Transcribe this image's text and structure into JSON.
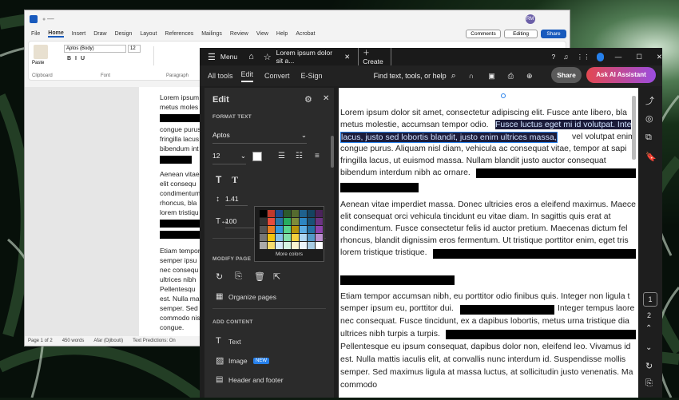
{
  "word": {
    "menu": [
      "File",
      "Home",
      "Insert",
      "Draw",
      "Design",
      "Layout",
      "References",
      "Mailings",
      "Review",
      "View",
      "Help",
      "Acrobat"
    ],
    "comments_label": "Comments",
    "editing_label": "Editing",
    "share_label": "Share",
    "font": "Aptos (Body)",
    "font_size": "12",
    "paste_label": "Paste",
    "ribbon_groups": [
      "Clipboard",
      "Font",
      "Paragraph"
    ],
    "lines": [
      "Lorem ipsum",
      "metus moles",
      "congue purus",
      "fringilla lacus",
      "bibendum int",
      "Aenean vitae",
      "elit consequ",
      "condimentum",
      "rhoncus, bla",
      "lorem tristiqu",
      "Etiam tempor",
      "semper ipsu",
      "nec consequ",
      "ultrices nibh",
      "Pellentesqu",
      "est. Nulla ma",
      "semper. Sed",
      "commodo nis",
      "congue."
    ],
    "status": [
      "Page 1 of 2",
      "450 words",
      "Afar (Djibouti)",
      "Text Predictions: On"
    ]
  },
  "acrobat": {
    "menu_label": "Menu",
    "tab_title": "Lorem ipsum dolor sit a...",
    "create_label": "Create",
    "nav": [
      "All tools",
      "Edit",
      "Convert",
      "E-Sign"
    ],
    "search_placeholder": "Find text, tools, or help",
    "share_label": "Share",
    "ai_label": "Ask AI Assistant",
    "panel": {
      "title": "Edit",
      "format_text": "FORMAT TEXT",
      "font": "Aptos",
      "size": "12",
      "line_spacing": "1.41",
      "scale": "100",
      "more_colors": "More colors",
      "modify_page": "MODIFY PAGE",
      "organize": "Organize pages",
      "add_content": "ADD CONTENT",
      "text": "Text",
      "image": "Image",
      "new_badge": "NEW",
      "header_footer": "Header and footer"
    },
    "doc_lines": [
      "Lorem ipsum dolor sit amet, consectetur adipiscing elit. Fusce ante libero, bla",
      "metus molestie, accumsan tempor odio.",
      "Fusce luctus eget mi id volutpat. Inte",
      "lacus, justo sed lobortis blandit, justo enim ultrices massa,",
      "vel volutpat enim",
      "congue purus. Aliquam nisl diam, vehicula ac consequat vitae, tempor at sapi",
      "fringilla lacus, ut euismod massa. Nullam blandit justo auctor consequat",
      "bibendum interdum nibh ac ornare.",
      "Aenean vitae imperdiet massa. Donec ultricies eros a eleifend maximus. Maece",
      "elit consequat orci vehicula tincidunt eu vitae diam. In sagittis quis erat at",
      "condimentum. Fusce consectetur felis id auctor pretium. Maecenas dictum fel",
      "rhoncus, blandit dignissim eros fermentum. Ut tristique porttitor enim, eget tris",
      "lorem tristique tristique.",
      "Etiam tempor accumsan nibh, eu porttitor odio finibus quis. Integer non ligula t",
      "semper ipsum eu, porttitor dui.",
      "Integer tempus laore",
      "nec consequat. Fusce tincidunt, ex a dapibus lobortis, metus urna tristique dia",
      "ultrices nibh turpis a turpis.",
      "Pellentesque eu ipsum consequat, dapibus dolor non, eleifend leo. Vivamus id",
      "est. Nulla mattis iaculis elit, at convallis nunc interdum id. Suspendisse mollis",
      "semper. Sed maximus ligula at massa luctus, at sollicitudin justo venenatis. Ma",
      "commodo"
    ],
    "pages": [
      "1",
      "2"
    ]
  },
  "colors": {
    "accent": "#2680eb",
    "share": "#5a5a5a",
    "ai_gradient_start": "#e34850",
    "ai_gradient_end": "#9b4de0"
  }
}
